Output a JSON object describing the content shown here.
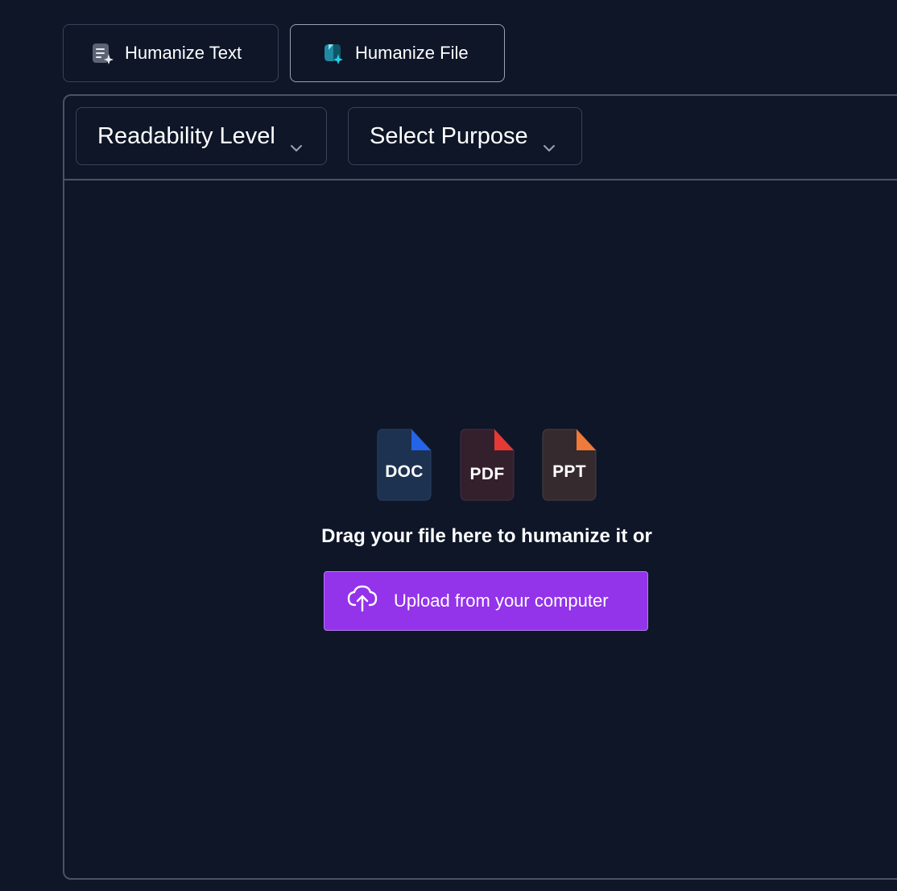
{
  "tabs": {
    "text_label": "Humanize Text",
    "file_label": "Humanize File"
  },
  "toolbar": {
    "readability_label": "Readability Level",
    "purpose_label": "Select Purpose"
  },
  "dropzone": {
    "file_types": [
      "DOC",
      "PDF",
      "PPT"
    ],
    "drag_text": "Drag your file here to humanize it or",
    "upload_label": "Upload from your computer"
  },
  "icons": {
    "humanize_text": "document-sparkle-icon",
    "humanize_file": "file-sparkle-icon",
    "upload": "cloud-upload-icon",
    "dropdown": "chevron-down-icon"
  },
  "colors": {
    "background": "#0e1628",
    "accent": "#9333ea",
    "doc": "#2563eb",
    "pdf": "#e53935",
    "ppt": "#f07a3a"
  }
}
